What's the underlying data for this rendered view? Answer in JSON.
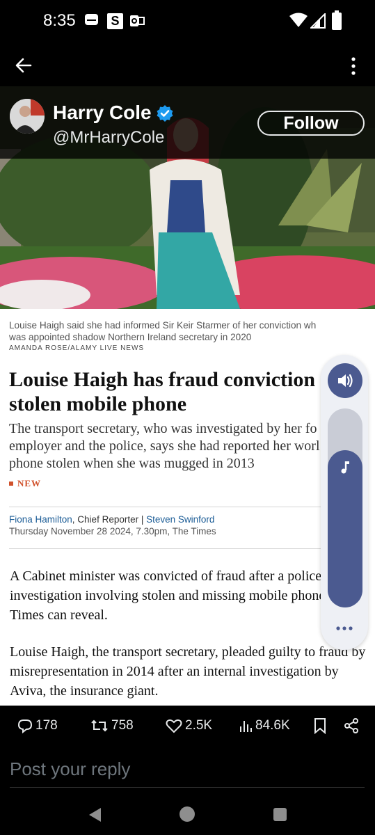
{
  "status_bar": {
    "time": "8:35",
    "notifications": [
      "mail-icon",
      "s-app-icon",
      "outlook-icon"
    ],
    "notif_s_label": "S",
    "system": [
      "wifi-icon",
      "signal-icon",
      "battery-icon"
    ]
  },
  "app_bar": {
    "back": "back-arrow-icon",
    "more": "more-vertical-icon"
  },
  "author": {
    "name": "Harry Cole",
    "handle": "@MrHarryCole",
    "verified": true,
    "follow_label": "Follow"
  },
  "article": {
    "caption_lines": [
      "Louise Haigh said she had informed Sir Keir Starmer of her conviction wh",
      "was appointed shadow Northern Ireland secretary in 2020"
    ],
    "photo_credit": "AMANDA ROSE/ALAMY LIVE NEWS",
    "headline_lines": [
      "Louise Haigh has fraud conviction o",
      "stolen mobile phone"
    ],
    "standfirst_lines": [
      "The transport secretary, who was investigated by her fo",
      "employer and the police, says she had reported her worl",
      "phone stolen when she was mugged in 2013"
    ],
    "tag": "NEW",
    "byline_author1": "Fiona Hamilton",
    "byline_role": ", Chief Reporter | ",
    "byline_author2": "Steven Swinford",
    "dateline": "Thursday November 28 2024, 7.30pm, The Times",
    "paragraphs": [
      "A Cabinet minister was convicted of fraud after a police investigation involving stolen and missing mobile phones, The Times can reveal.",
      "Louise Haigh, the transport secretary, pleaded guilty to fraud by misrepresentation in 2014 after an internal investigation by Aviva, the insurance giant."
    ]
  },
  "volume_panel": {
    "speaker": "speaker-icon",
    "stream": "music-note-icon",
    "level": 0.79,
    "more": "more-horizontal-icon",
    "accent": "#4b5a90"
  },
  "actions": {
    "replies": "178",
    "reposts": "758",
    "likes": "2.5K",
    "views": "84.6K"
  },
  "reply": {
    "placeholder": "Post your reply"
  },
  "colors": {
    "background": "#000000",
    "verified_blue": "#1d9bf0",
    "times_link": "#1b5c96",
    "new_tag": "#d0512b"
  }
}
